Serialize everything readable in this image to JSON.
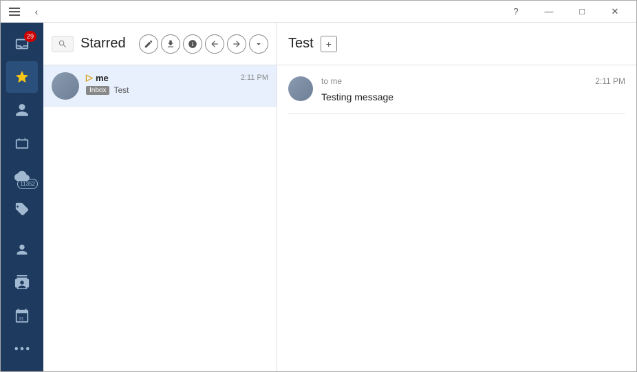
{
  "window": {
    "title": "Starred"
  },
  "titlebar": {
    "back_label": "‹",
    "help_label": "?",
    "minimize_label": "—",
    "maximize_label": "□",
    "close_label": "✕"
  },
  "sidebar": {
    "items": [
      {
        "name": "inbox-icon",
        "label": "inbox",
        "icon": "inbox",
        "active": false,
        "badge": "29"
      },
      {
        "name": "starred-icon",
        "label": "starred",
        "icon": "star",
        "active": true,
        "badge": ""
      },
      {
        "name": "contacts-icon",
        "label": "contacts",
        "icon": "contacts",
        "active": false,
        "badge": ""
      },
      {
        "name": "briefcase-icon",
        "label": "briefcase",
        "icon": "briefcase",
        "active": false,
        "badge": ""
      },
      {
        "name": "cloud-icon",
        "label": "cloud",
        "icon": "cloud",
        "active": false,
        "badge": "11352"
      },
      {
        "name": "tags-icon",
        "label": "tags",
        "icon": "tags",
        "active": false,
        "badge": ""
      },
      {
        "name": "person-icon",
        "label": "person",
        "icon": "person",
        "active": false,
        "badge": ""
      },
      {
        "name": "contacts2-icon",
        "label": "contacts2",
        "icon": "contacts2",
        "active": false,
        "badge": ""
      },
      {
        "name": "calendar-icon",
        "label": "calendar",
        "icon": "calendar",
        "active": false,
        "badge": ""
      },
      {
        "name": "more-icon",
        "label": "more",
        "icon": "more",
        "active": false,
        "badge": ""
      }
    ]
  },
  "email_list": {
    "search_placeholder": "Search",
    "panel_title": "Starred",
    "toolbar": {
      "compose": "✎",
      "download": "↓",
      "info": "i",
      "back": "↺",
      "forward": "↻",
      "more": "▾"
    },
    "emails": [
      {
        "sender": "me",
        "sender_icon": "▷",
        "time": "2:11 PM",
        "tag": "Inbox",
        "subject": "Test",
        "selected": true
      }
    ]
  },
  "email_detail": {
    "title": "Test",
    "add_tab_label": "+",
    "message": {
      "to": "to me",
      "time": "2:11 PM",
      "body": "Testing message"
    }
  }
}
